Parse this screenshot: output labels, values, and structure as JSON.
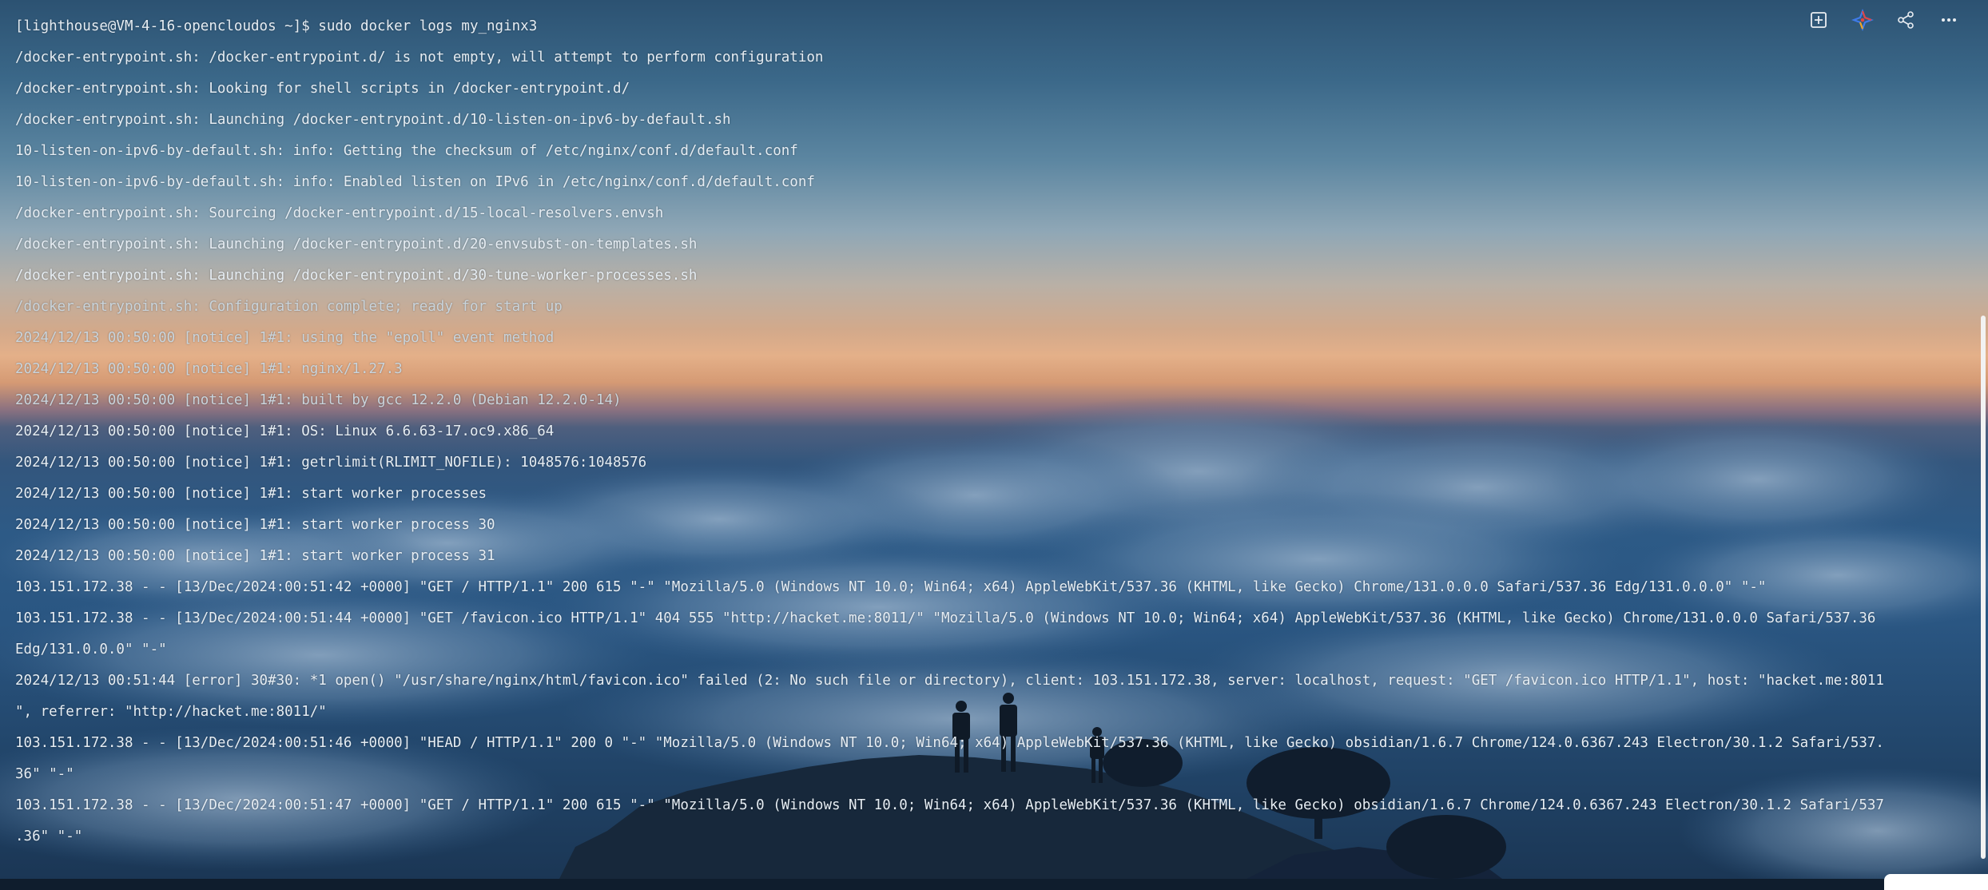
{
  "terminal": {
    "lines": [
      "[lighthouse@VM-4-16-opencloudos ~]$ sudo docker logs my_nginx3",
      "/docker-entrypoint.sh: /docker-entrypoint.d/ is not empty, will attempt to perform configuration",
      "/docker-entrypoint.sh: Looking for shell scripts in /docker-entrypoint.d/",
      "/docker-entrypoint.sh: Launching /docker-entrypoint.d/10-listen-on-ipv6-by-default.sh",
      "10-listen-on-ipv6-by-default.sh: info: Getting the checksum of /etc/nginx/conf.d/default.conf",
      "10-listen-on-ipv6-by-default.sh: info: Enabled listen on IPv6 in /etc/nginx/conf.d/default.conf",
      "/docker-entrypoint.sh: Sourcing /docker-entrypoint.d/15-local-resolvers.envsh",
      "/docker-entrypoint.sh: Launching /docker-entrypoint.d/20-envsubst-on-templates.sh",
      "/docker-entrypoint.sh: Launching /docker-entrypoint.d/30-tune-worker-processes.sh",
      "/docker-entrypoint.sh: Configuration complete; ready for start up",
      "2024/12/13 00:50:00 [notice] 1#1: using the \"epoll\" event method",
      "2024/12/13 00:50:00 [notice] 1#1: nginx/1.27.3",
      "2024/12/13 00:50:00 [notice] 1#1: built by gcc 12.2.0 (Debian 12.2.0-14)",
      "2024/12/13 00:50:00 [notice] 1#1: OS: Linux 6.6.63-17.oc9.x86_64",
      "2024/12/13 00:50:00 [notice] 1#1: getrlimit(RLIMIT_NOFILE): 1048576:1048576",
      "2024/12/13 00:50:00 [notice] 1#1: start worker processes",
      "2024/12/13 00:50:00 [notice] 1#1: start worker process 30",
      "2024/12/13 00:50:00 [notice] 1#1: start worker process 31",
      "103.151.172.38 - - [13/Dec/2024:00:51:42 +0000] \"GET / HTTP/1.1\" 200 615 \"-\" \"Mozilla/5.0 (Windows NT 10.0; Win64; x64) AppleWebKit/537.36 (KHTML, like Gecko) Chrome/131.0.0.0 Safari/537.36 Edg/131.0.0.0\" \"-\"",
      "103.151.172.38 - - [13/Dec/2024:00:51:44 +0000] \"GET /favicon.ico HTTP/1.1\" 404 555 \"http://hacket.me:8011/\" \"Mozilla/5.0 (Windows NT 10.0; Win64; x64) AppleWebKit/537.36 (KHTML, like Gecko) Chrome/131.0.0.0 Safari/537.36",
      "Edg/131.0.0.0\" \"-\"",
      "2024/12/13 00:51:44 [error] 30#30: *1 open() \"/usr/share/nginx/html/favicon.ico\" failed (2: No such file or directory), client: 103.151.172.38, server: localhost, request: \"GET /favicon.ico HTTP/1.1\", host: \"hacket.me:8011",
      "\", referrer: \"http://hacket.me:8011/\"",
      "103.151.172.38 - - [13/Dec/2024:00:51:46 +0000] \"HEAD / HTTP/1.1\" 200 0 \"-\" \"Mozilla/5.0 (Windows NT 10.0; Win64; x64) AppleWebKit/537.36 (KHTML, like Gecko) obsidian/1.6.7 Chrome/124.0.6367.243 Electron/30.1.2 Safari/537.",
      "36\" \"-\"",
      "103.151.172.38 - - [13/Dec/2024:00:51:47 +0000] \"GET / HTTP/1.1\" 200 615 \"-\" \"Mozilla/5.0 (Windows NT 10.0; Win64; x64) AppleWebKit/537.36 (KHTML, like Gecko) obsidian/1.6.7 Chrome/124.0.6367.243 Electron/30.1.2 Safari/537",
      ".36\" \"-\""
    ]
  },
  "toolbar": {
    "icons": [
      "new-tab-icon",
      "ai-assistant-icon",
      "share-icon",
      "more-icon"
    ]
  },
  "colors": {
    "text": "#e6edf3",
    "scrollbar": "#f2f2f2"
  }
}
